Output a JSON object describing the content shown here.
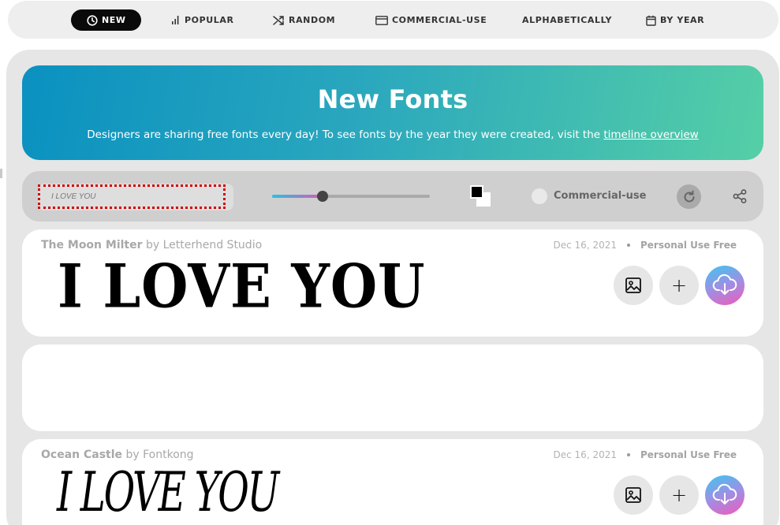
{
  "nav": {
    "items": [
      {
        "label": "NEW",
        "icon": "clock-icon",
        "active": true
      },
      {
        "label": "POPULAR",
        "icon": "bar-chart-icon",
        "active": false
      },
      {
        "label": "RANDOM",
        "icon": "shuffle-icon",
        "active": false
      },
      {
        "label": "COMMERCIAL-USE",
        "icon": "card-icon",
        "active": false
      },
      {
        "label": "ALPHABETICALLY",
        "icon": "",
        "active": false
      },
      {
        "label": "BY YEAR",
        "icon": "calendar-icon",
        "active": false
      }
    ]
  },
  "hero": {
    "title": "New Fonts",
    "subtitle": "Designers are sharing free fonts every day! To see fonts by the year they were created, visit the ",
    "link": "timeline overview"
  },
  "controls": {
    "preview_text": "I LOVE YOU",
    "size_level": 0.32,
    "text_color": "#000000",
    "bg_color": "#ffffff",
    "commercial_label": "Commercial-use",
    "icons": {
      "reset": "refresh-icon",
      "share": "share-icon"
    }
  },
  "fonts": [
    {
      "name": "The Moon Milter",
      "by": "by",
      "author": "Letterhend Studio",
      "date": "Dec 16, 2021",
      "license": "Personal Use Free",
      "sample": "I LOVE YOU"
    },
    {
      "name": "Ocean Castle",
      "by": "by",
      "author": "Fontkong",
      "date": "Dec 16, 2021",
      "license": "Personal Use Free",
      "sample": "I LOVE YOU"
    }
  ],
  "actions": {
    "image": "image-icon",
    "add": "+",
    "download": "cloud-download-icon"
  },
  "colors": {
    "accent_dark": "#0a0a0a",
    "hero_start": "#0a91c0",
    "hero_end": "#55cfa6",
    "download_start": "#3cc6ef",
    "download_end": "#ef5bbb",
    "error_outline": "#d40000"
  }
}
